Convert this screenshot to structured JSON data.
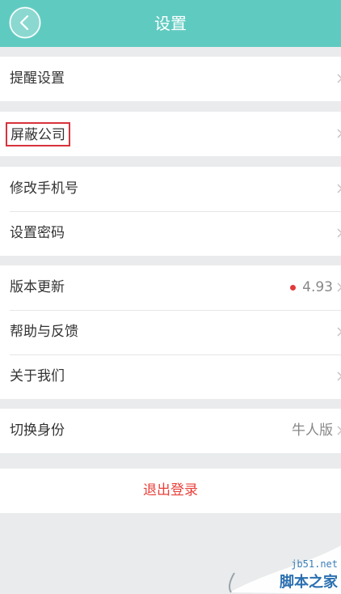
{
  "header": {
    "title": "设置",
    "back_icon": "chevron-left-icon"
  },
  "groups": [
    {
      "items": [
        {
          "label": "提醒设置"
        }
      ]
    },
    {
      "items": [
        {
          "label": "屏蔽公司",
          "highlighted": true
        }
      ]
    },
    {
      "items": [
        {
          "label": "修改手机号"
        },
        {
          "label": "设置密码"
        }
      ]
    },
    {
      "items": [
        {
          "label": "版本更新",
          "value": "4.93",
          "badge": "red-dot"
        },
        {
          "label": "帮助与反馈"
        },
        {
          "label": "关于我们"
        }
      ]
    },
    {
      "items": [
        {
          "label": "切换身份",
          "value": "牛人版"
        }
      ]
    }
  ],
  "logout": {
    "label": "退出登录"
  },
  "watermark": {
    "url": "jb51.net",
    "name": "脚本之家"
  },
  "colors": {
    "header_bg": "#5fcac0",
    "logout_text": "#e8403a",
    "highlight_border": "#d8333a",
    "badge": "#e2393a"
  }
}
